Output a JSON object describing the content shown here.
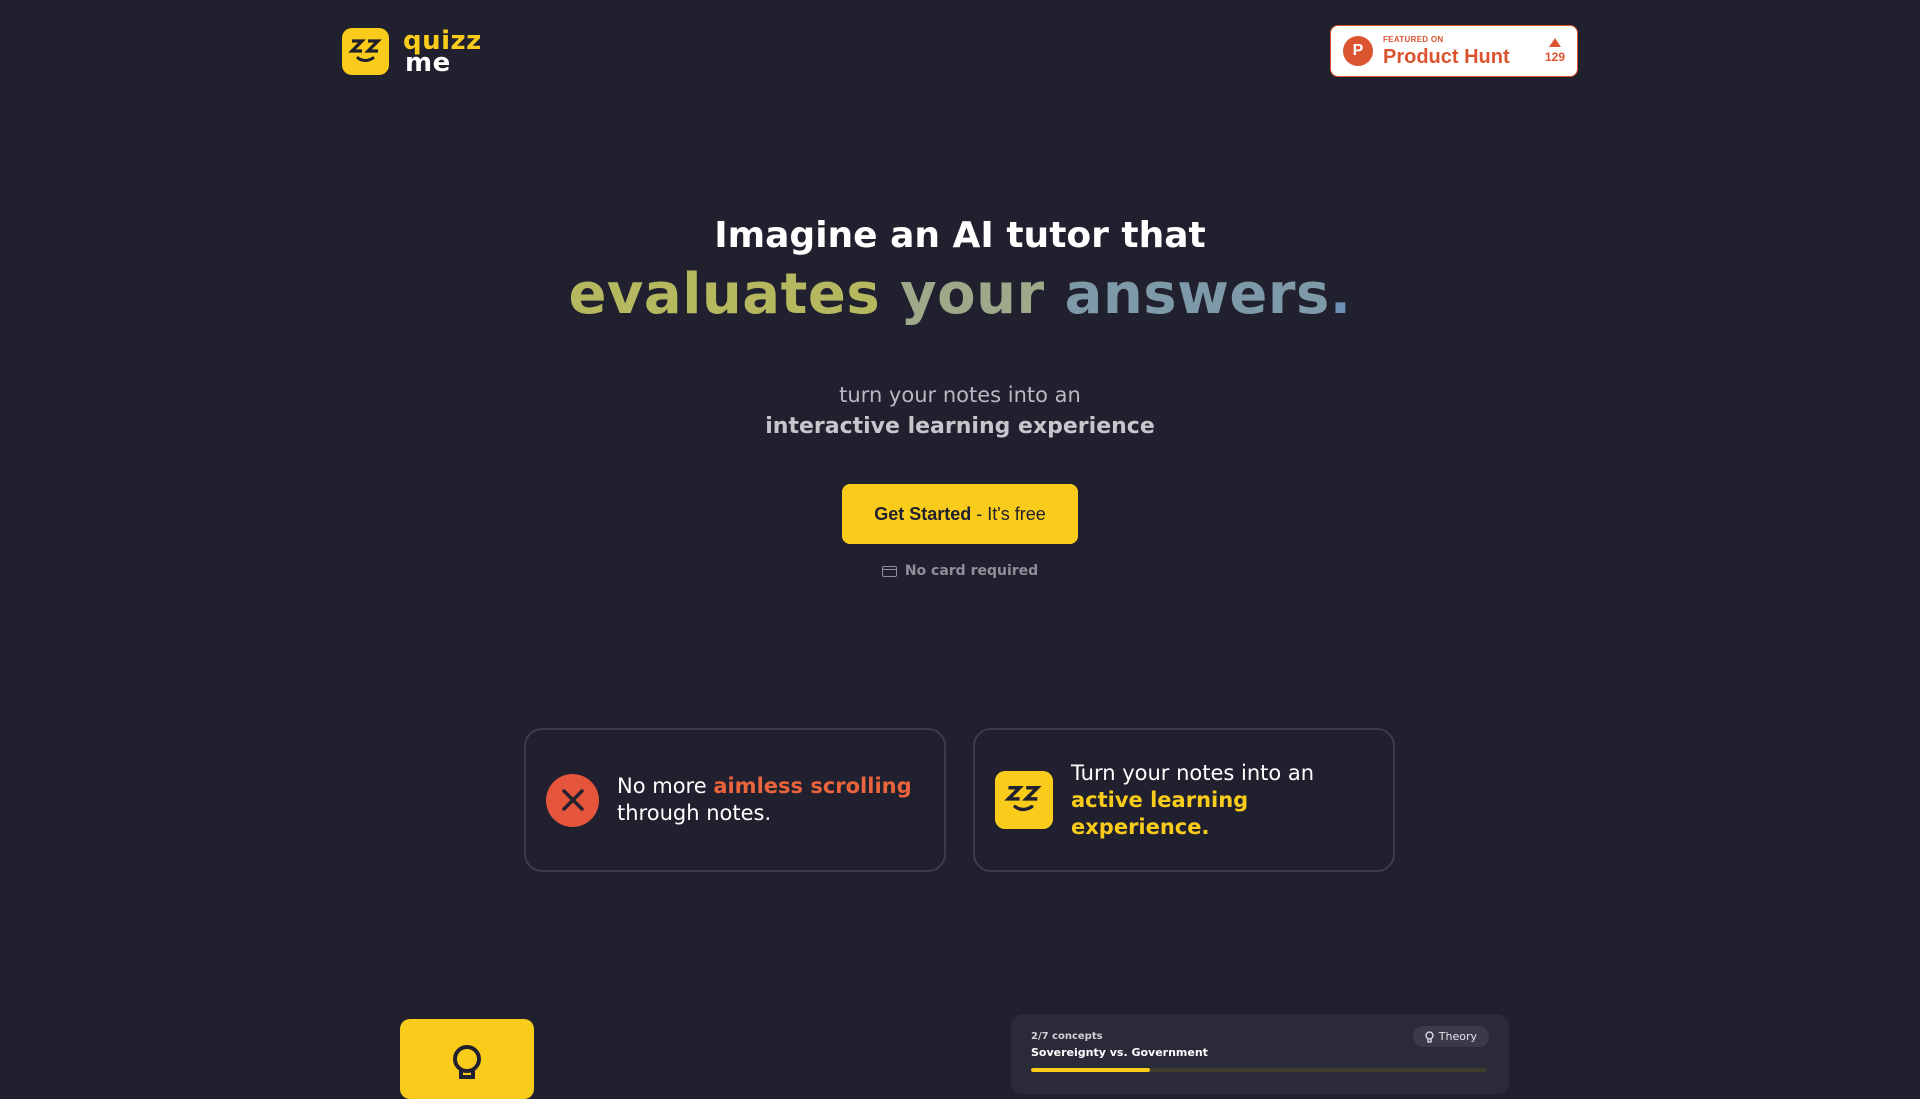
{
  "header": {
    "logo_line1": "quizz",
    "logo_line2": "me",
    "logo_icon": "zz-smiley-icon",
    "producthunt": {
      "small": "FEATURED ON",
      "big": "Product Hunt",
      "votes": "129",
      "icon": "producthunt-icon"
    }
  },
  "hero": {
    "line1": "Imagine an AI tutor that",
    "line2_words": [
      "evaluates",
      "your",
      "answers",
      "."
    ],
    "sub1": "turn your notes into an",
    "sub2": "interactive learning experience",
    "cta_bold": "Get Started",
    "cta_rest": "- It's free",
    "no_card": "No card required"
  },
  "features": [
    {
      "prefix": "No more ",
      "highlight": "aimless scrolling",
      "suffix": "through notes.",
      "icon": "x-circle-icon"
    },
    {
      "prefix": "Turn your notes into an",
      "highlight": "active learning experience.",
      "suffix": "",
      "icon": "zz-smiley-icon"
    }
  ],
  "quiz_preview": {
    "concepts": "2/7 concepts",
    "title": "Sovereignty vs. Government",
    "tag": "Theory",
    "progress": 0.26
  },
  "colors": {
    "background": "#21202e",
    "brand_yellow": "#f9cc1c",
    "accent_red": "#e9633c",
    "producthunt": "#da552f"
  }
}
